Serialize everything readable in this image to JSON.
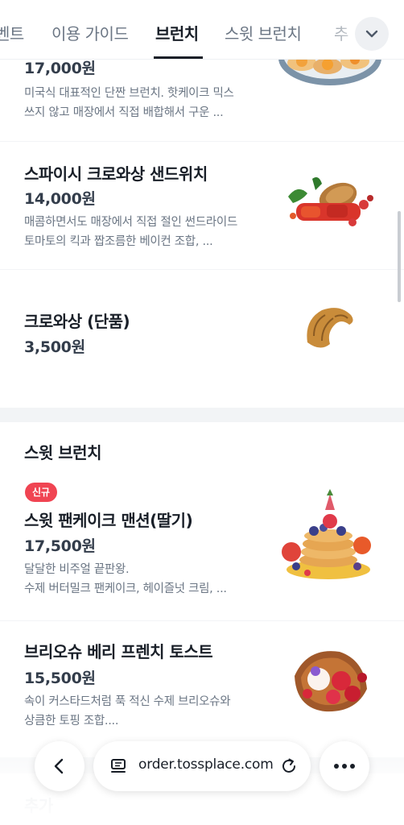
{
  "tabs": [
    {
      "label": "벤트"
    },
    {
      "label": "이용 가이드"
    },
    {
      "label": "브런치"
    },
    {
      "label": "스윗 브런치"
    },
    {
      "label": "추"
    }
  ],
  "active_tab": "브런치",
  "top_item": {
    "price": "17,000원",
    "desc_line1": "미국식 대표적인 단짠 브런치. 핫케이크 믹스",
    "desc_line2": "쓰지 않고 매장에서 직접 배합해서 구운 ..."
  },
  "brunch_items": [
    {
      "name": "스파이시 크로와상 샌드위치",
      "price": "14,000원",
      "desc_line1": "매콤하면서도 매장에서 직접 절인 썬드라이드",
      "desc_line2": "토마토의 킥과 짭조름한 베이컨 조합, ..."
    },
    {
      "name": "크로와상 (단품)",
      "price": "3,500원"
    }
  ],
  "sweet_section": {
    "title": "스윗 브런치",
    "items": [
      {
        "badge": "신규",
        "name": "스윗 팬케이크 맨션(딸기)",
        "price": "17,500원",
        "desc_line1": "달달한 비주얼 끝판왕.",
        "desc_line2": "수제 버터밀크 팬케이크, 헤이즐넛 크림, ..."
      },
      {
        "name": "브리오슈 베리 프렌치 토스트",
        "price": "15,500원",
        "desc_line1": "속이 커스타드처럼 푹 적신 수제 브리오슈와",
        "desc_line2": "상큼한 토핑 조합...."
      }
    ]
  },
  "next_section": {
    "title": "추가"
  },
  "browser": {
    "url": "order.tossplace.com"
  },
  "colors": {
    "badge_red": "#f04452",
    "text_primary": "#191f28",
    "text_secondary": "#6b7684",
    "divider": "#f2f4f6"
  },
  "icons": [
    "chevron-down-icon",
    "back-arrow-icon",
    "tabs-icon",
    "reload-icon",
    "more-icon"
  ]
}
